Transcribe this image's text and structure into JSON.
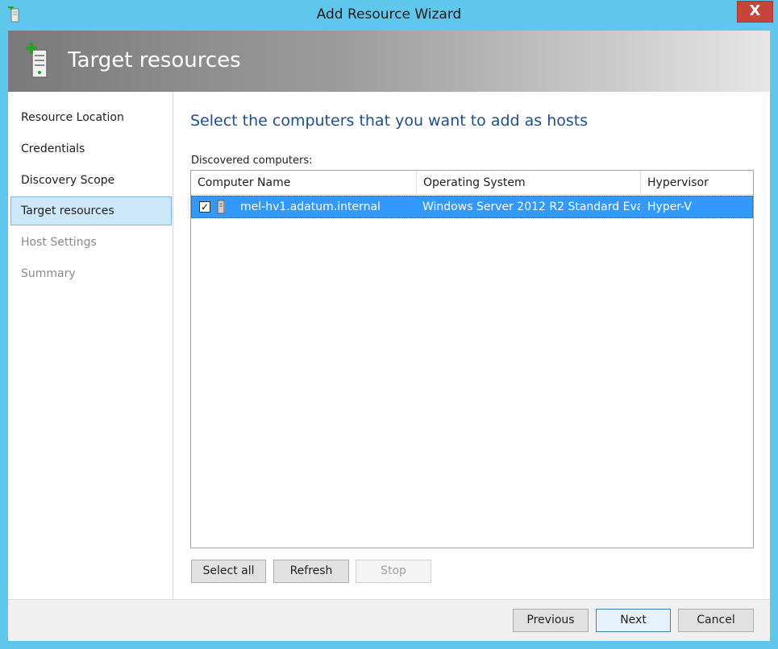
{
  "window": {
    "title": "Add Resource Wizard",
    "close_glyph": "X"
  },
  "banner": {
    "title": "Target resources"
  },
  "nav": {
    "items": [
      {
        "label": "Resource Location",
        "state": "done"
      },
      {
        "label": "Credentials",
        "state": "done"
      },
      {
        "label": "Discovery Scope",
        "state": "done"
      },
      {
        "label": "Target resources",
        "state": "active"
      },
      {
        "label": "Host Settings",
        "state": "disabled"
      },
      {
        "label": "Summary",
        "state": "disabled"
      }
    ]
  },
  "main": {
    "heading": "Select the computers that you want to add as hosts",
    "list_label": "Discovered computers:",
    "columns": [
      "Computer Name",
      "Operating System",
      "Hypervisor"
    ],
    "rows": [
      {
        "checked": true,
        "computer_name": "mel-hv1.adatum.internal",
        "operating_system": "Windows Server 2012 R2 Standard Eval...",
        "hypervisor": "Hyper-V"
      }
    ],
    "buttons": {
      "select_all": "Select all",
      "refresh": "Refresh",
      "stop": "Stop"
    }
  },
  "footer": {
    "previous": "Previous",
    "next": "Next",
    "cancel": "Cancel"
  },
  "colors": {
    "frame": "#5fc7ec",
    "selection": "#3399ff",
    "heading": "#1e4e8c",
    "close": "#c7443a"
  }
}
